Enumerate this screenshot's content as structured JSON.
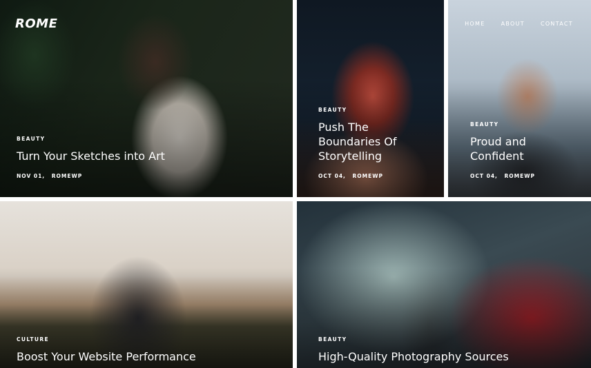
{
  "header": {
    "logo": "ROME",
    "nav": [
      {
        "label": "HOME"
      },
      {
        "label": "ABOUT"
      },
      {
        "label": "CONTACT"
      }
    ]
  },
  "posts": [
    {
      "category": "BEAUTY",
      "title": "Turn Your Sketches into Art",
      "date": "NOV 01,",
      "author": "ROMEWP"
    },
    {
      "category": "BEAUTY",
      "title": "Push The Boundaries Of Storytelling",
      "date": "OCT 04,",
      "author": "ROMEWP"
    },
    {
      "category": "BEAUTY",
      "title": "Proud and Confident",
      "date": "OCT 04,",
      "author": "ROMEWP"
    },
    {
      "category": "CULTURE",
      "title": "Boost Your Website Performance"
    },
    {
      "category": "BEAUTY",
      "title": "High-Quality Photography Sources"
    }
  ]
}
